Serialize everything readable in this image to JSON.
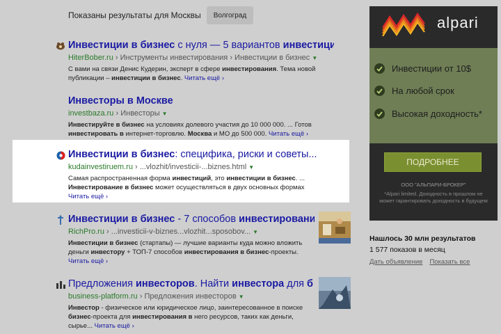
{
  "region": {
    "text": "Показаны результаты для Москвы",
    "button": "Волгоград"
  },
  "results": [
    {
      "title_parts": [
        [
          "Инвестиции в бизнес",
          true
        ],
        [
          " с нуля — 5 вариантов ",
          false
        ],
        [
          "инвестиций",
          true
        ],
        [
          "...",
          false
        ]
      ],
      "domain": "HiterBober.ru",
      "crumbs": [
        "Инструменты инвестирования",
        "Инвестиции в бизнес"
      ],
      "snippet_parts": [
        [
          "С вами на связи Денис Кудерин, эксперт в сфере ",
          false
        ],
        [
          "инвестирования",
          true
        ],
        [
          ". Тема новой публикации – ",
          false
        ],
        [
          "инвестиции в бизнес",
          true
        ],
        [
          ". ",
          false
        ]
      ],
      "more": "Читать ещё"
    },
    {
      "title_parts": [
        [
          "Инвесторы в Москве",
          true
        ]
      ],
      "domain": "investbaza.ru",
      "crumbs": [
        "Инвесторы"
      ],
      "snippet_parts": [
        [
          "Инвестируйте в бизнес",
          true
        ],
        [
          " на условиях долевого участия до 10 000 000. ... Готов ",
          false
        ],
        [
          "инвестировать в",
          true
        ],
        [
          " интернет-торговлю. ",
          false
        ],
        [
          "Москва",
          true
        ],
        [
          " и МО до 500 000. ",
          false
        ]
      ],
      "more": "Читать ещё"
    },
    {
      "title_parts": [
        [
          "Инвестиции в бизнес",
          true
        ],
        [
          ": специфика, риски и советы...",
          false
        ]
      ],
      "domain": "kudainvestiruem.ru",
      "crumbs": [
        "...vlozhit/investicii-...biznes.html"
      ],
      "snippet_parts": [
        [
          "Самая распространенная форма ",
          false
        ],
        [
          "инвестиций",
          true
        ],
        [
          ", это ",
          false
        ],
        [
          "инвестиции в бизнес",
          true
        ],
        [
          ". ... ",
          false
        ],
        [
          "Инвестирование в бизнес",
          true
        ],
        [
          " может осуществляться в двух основных формах",
          false
        ]
      ],
      "more": "Читать ещё"
    },
    {
      "title_parts": [
        [
          "Инвестиции в бизнес",
          true
        ],
        [
          " - 7 способов ",
          false
        ],
        [
          "инвестировани",
          true
        ],
        [
          "...",
          false
        ]
      ],
      "domain": "RichPro.ru",
      "crumbs": [
        "...investicii-v-biznes...vlozhit...sposobov..."
      ],
      "snippet_parts": [
        [
          "Инвестиции в бизнес",
          true
        ],
        [
          " (стартапы) — лучшие варианты куда можно вложить деньги ",
          false
        ],
        [
          "инвестору",
          true
        ],
        [
          " + ТОП-7 способов ",
          false
        ],
        [
          "инвестирования в бизнес",
          true
        ],
        [
          "-проекты. ",
          false
        ]
      ],
      "more": "Читать ещё"
    },
    {
      "title_parts": [
        [
          "Предложения ",
          false
        ],
        [
          "инвесторов",
          true
        ],
        [
          ". Найти ",
          false
        ],
        [
          "инвестора",
          true
        ],
        [
          " для ",
          false
        ],
        [
          "б",
          true
        ]
      ],
      "domain": "business-platform.ru",
      "crumbs": [
        "Предложения инвесторов"
      ],
      "snippet_parts": [
        [
          "Инвестор",
          true
        ],
        [
          " - физическое или юридическое лицо, заинтересованное в поиске ",
          false
        ],
        [
          "бизнес",
          true
        ],
        [
          "-проекта для ",
          false
        ],
        [
          "инвестирования в",
          true
        ],
        [
          " него ресурсов, таких как деньги, сырье... ",
          false
        ]
      ],
      "more": "Читать ещё"
    }
  ],
  "ad": {
    "brand": "alpari",
    "features": [
      "Инвестиции от 10$",
      "На любой срок",
      "Высокая доходность*"
    ],
    "cta": "ПОДРОБНЕЕ",
    "company": "ООО \"АЛЬПАРИ-БРОКЕР\"",
    "disclaimer": "*Alpari limited. Доходность в прошлом не может гарантировать доходность в будущем",
    "colors": {
      "logo_red": "#d8262b",
      "logo_orange": "#f28c1e",
      "green_panel": "#6f7e55"
    }
  },
  "stats": {
    "found": "Нашлось 30 млн результатов",
    "shows": "1 577 показов в месяц",
    "links": [
      "Дать объявление",
      "Показать все"
    ]
  }
}
